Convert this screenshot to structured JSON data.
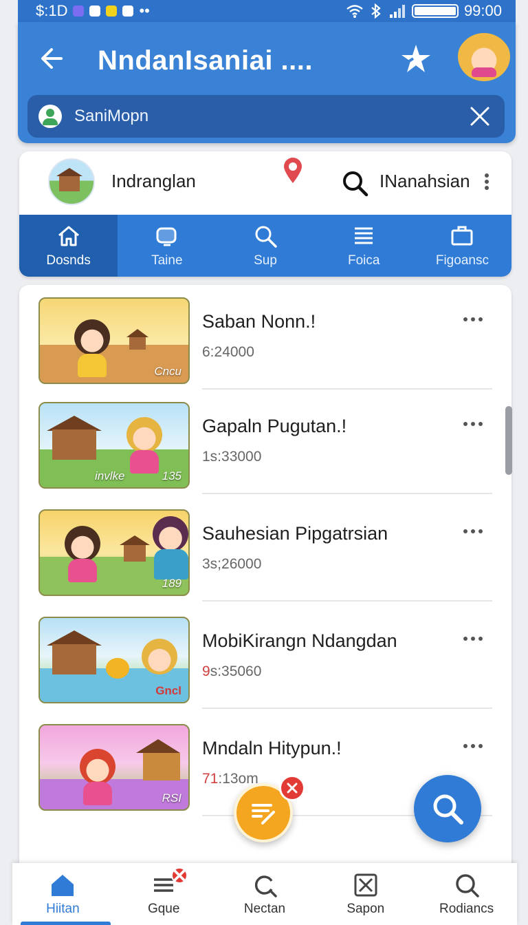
{
  "status_bar": {
    "left_text": "$:1D",
    "right_text": "99:00"
  },
  "header": {
    "title": "NndanIsaniai ....",
    "search_value": "SaniMopn"
  },
  "location": {
    "name": "Indranglan",
    "right_label": "INanahsian"
  },
  "tabs": [
    {
      "label": "Dosnds",
      "icon": "home-icon",
      "active": true
    },
    {
      "label": "Taine",
      "icon": "tv-icon"
    },
    {
      "label": "Sup",
      "icon": "search-icon"
    },
    {
      "label": "Foica",
      "icon": "list-icon"
    },
    {
      "label": "Figoansc",
      "icon": "briefcase-icon"
    }
  ],
  "list": [
    {
      "title": "Saban Nonn.!",
      "time": "6:24000",
      "tag": "",
      "badge": "Cncu"
    },
    {
      "title": "Gapaln Pugutan.!",
      "time": "1s:33000",
      "tag": "invlke",
      "badge": "135"
    },
    {
      "title": "Sauhesian Pipgatrsian",
      "time": "3s;26000",
      "tag": "",
      "badge": "189"
    },
    {
      "title": "MobiKirangn Ndangdan",
      "time_prefix": "9",
      "time": "s:35060",
      "tag": "",
      "badge": "Gncl"
    },
    {
      "title": "Mndaln Hitypun.!",
      "time_prefix": "71",
      "time": ":13om",
      "tag": "",
      "badge": "RSI"
    }
  ],
  "bottom_nav": [
    {
      "label": "Hiitan",
      "icon": "home-icon",
      "active": true
    },
    {
      "label": "Gque",
      "icon": "menu-icon",
      "badge": true
    },
    {
      "label": "Nectan",
      "icon": "refresh-search-icon"
    },
    {
      "label": "Sapon",
      "icon": "box-x-icon"
    },
    {
      "label": "Rodiancs",
      "icon": "search-icon"
    }
  ],
  "colors": {
    "primary": "#3a82d6",
    "primary_dark": "#1f5fae",
    "accent": "#f4a620",
    "danger": "#e23b35"
  }
}
